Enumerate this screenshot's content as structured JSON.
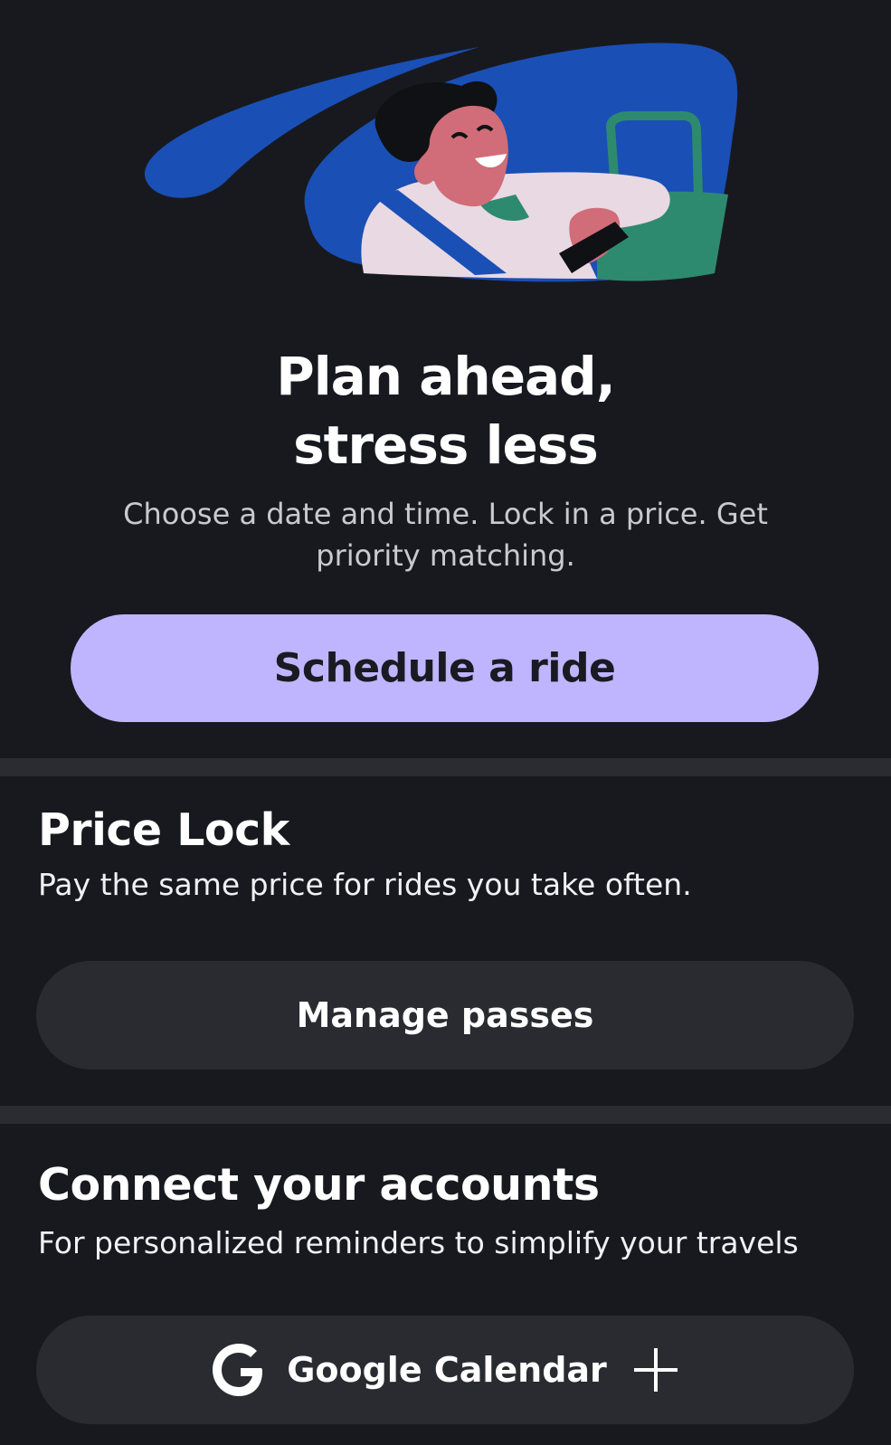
{
  "hero": {
    "title_line1": "Plan ahead,",
    "title_line2": "stress less",
    "subtitle": "Choose a date and time. Lock in a price. Get priority matching.",
    "cta_label": "Schedule a ride",
    "illustration_icon": "person-in-car-illustration"
  },
  "price_lock": {
    "title": "Price Lock",
    "description": "Pay the same price for rides you take often.",
    "button_label": "Manage passes"
  },
  "accounts": {
    "title": "Connect your accounts",
    "description": "For personalized reminders to simplify your travels",
    "google_button_label": "Google Calendar",
    "google_icon": "google-g-icon",
    "add_icon": "plus-icon"
  },
  "colors": {
    "background": "#18191f",
    "primary_button": "#bfb5ff",
    "secondary_button": "#2a2b30",
    "separator": "#2b2c32",
    "illustration_blue": "#1a4fb5",
    "illustration_green": "#2e8a6e",
    "illustration_skin": "#d06d78"
  }
}
